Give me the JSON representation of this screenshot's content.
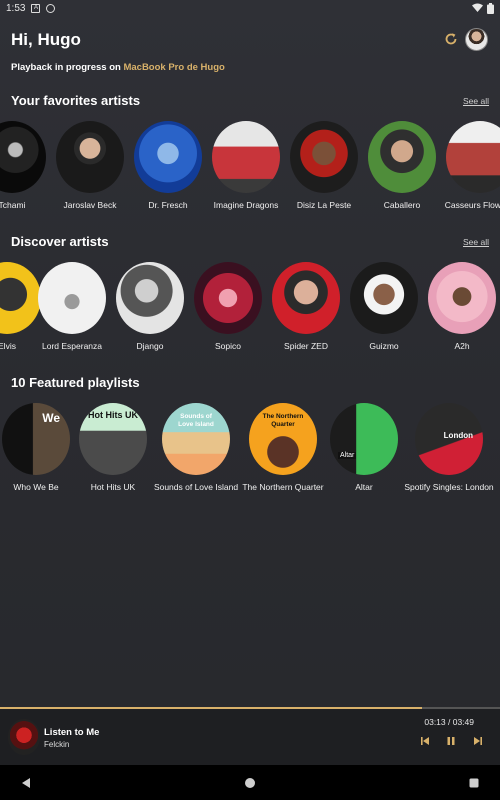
{
  "status_bar": {
    "time": "1:53"
  },
  "header": {
    "greeting": "Hi, Hugo",
    "playback_prefix": "Playback in progress on",
    "device": "MacBook Pro de Hugo"
  },
  "favorites": {
    "title": "Your favorites artists",
    "see_all": "See all",
    "items": [
      {
        "label": "Tchami"
      },
      {
        "label": "Jaroslav Beck"
      },
      {
        "label": "Dr. Fresch"
      },
      {
        "label": "Imagine Dragons"
      },
      {
        "label": "Disiz La Peste"
      },
      {
        "label": "Caballero"
      },
      {
        "label": "Casseurs Flowters"
      }
    ]
  },
  "discover": {
    "title": "Discover artists",
    "see_all": "See all",
    "items": [
      {
        "label": "Elvis"
      },
      {
        "label": "Lord Esperanza"
      },
      {
        "label": "Django"
      },
      {
        "label": "Sopico"
      },
      {
        "label": "Spider ZED"
      },
      {
        "label": "Guizmo"
      },
      {
        "label": "A2h"
      }
    ]
  },
  "playlists": {
    "title": "10 Featured playlists",
    "items": [
      {
        "label": "Who We Be",
        "cover_text": "We"
      },
      {
        "label": "Hot Hits UK",
        "cover_text": "Hot Hits UK"
      },
      {
        "label": "Sounds of Love Island",
        "cover_text": "Sounds of Love Island"
      },
      {
        "label": "The Northern Quarter",
        "cover_text": "The Northern Quarter"
      },
      {
        "label": "Altar",
        "cover_text": "Altar"
      },
      {
        "label": "Spotify Singles: London",
        "cover_text": "London"
      }
    ]
  },
  "player": {
    "title": "Listen to Me",
    "artist": "Felckin",
    "time": "03:13 / 03:49",
    "progress": 0.843
  },
  "colors": {
    "accent": "#d8b16a",
    "background": "#2b2c31",
    "player_bg": "#1e1f22"
  },
  "icons": [
    "refresh-icon",
    "previous-icon",
    "pause-icon",
    "next-icon",
    "back-icon",
    "home-icon",
    "recents-icon",
    "wifi-icon",
    "battery-icon"
  ]
}
